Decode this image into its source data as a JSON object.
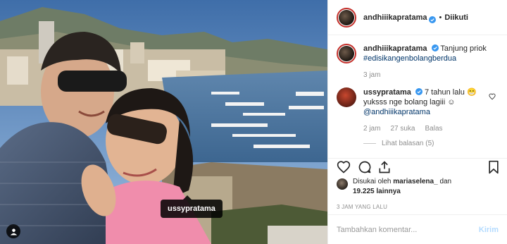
{
  "header": {
    "username": "andhiiikapratama",
    "dot": "•",
    "follow_status": "Diikuti"
  },
  "caption": {
    "username": "andhiiikapratama",
    "text": "Tanjung priok",
    "hashtag": "#edisikangenbolangberdua",
    "age": "3 jam"
  },
  "comment": {
    "username": "ussypratama",
    "line1": "7 tahun lalu",
    "line2": "yuksss nge bolang lagiii",
    "mention": "@andhiiikapratama",
    "age": "2 jam",
    "likes": "27 suka",
    "reply": "Balas",
    "view_replies": "Lihat balasan (5)"
  },
  "likes": {
    "prefix": "Disukai oleh",
    "user": "mariaselena_",
    "conj": "dan",
    "count": "19.225",
    "suffix": "lainnya"
  },
  "timestamp": "3 JAM YANG LALU",
  "comment_box": {
    "placeholder": "Tambahkan komentar...",
    "post_label": "Kirim"
  },
  "photo_tag": "ussypratama",
  "icons": {
    "heart": "heart-icon",
    "comment": "comment-icon",
    "share": "share-icon",
    "save": "bookmark-icon",
    "user_tag": "user-tag-icon",
    "verified": "verified-badge-icon"
  },
  "colors": {
    "verified": "#3897f0",
    "link": "#003569",
    "muted": "#8e8e8e",
    "post_button": "#b3dbff"
  }
}
